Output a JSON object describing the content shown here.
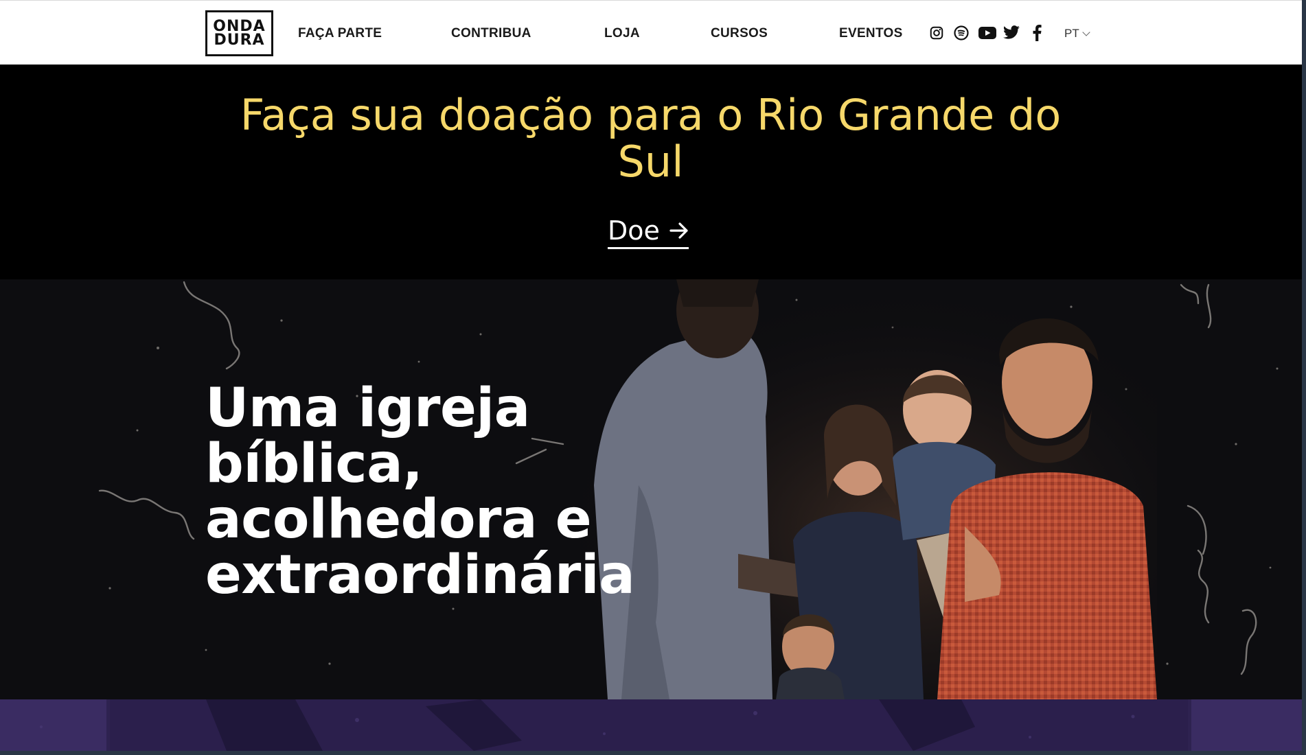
{
  "header": {
    "logo": {
      "line1": "ONDA",
      "line2": "DURA"
    },
    "nav": [
      "FAÇA PARTE",
      "CONTRIBUA",
      "LOJA",
      "CURSOS",
      "EVENTOS"
    ],
    "social_icons": [
      "instagram-icon",
      "spotify-icon",
      "youtube-icon",
      "twitter-icon",
      "facebook-icon"
    ],
    "language": "PT"
  },
  "banner": {
    "title": "Faça sua doação para o Rio Grande do Sul",
    "cta": "Doe"
  },
  "hero": {
    "title_line1": "Uma igreja",
    "title_line2": "bíblica,",
    "title_line3": "acolhedora e",
    "title_line4": "extraordinária"
  },
  "colors": {
    "banner_text": "#f6d86a",
    "banner_bg": "#000000",
    "hero_bg": "#0d0d10",
    "strip_bg": "#2e2250"
  }
}
